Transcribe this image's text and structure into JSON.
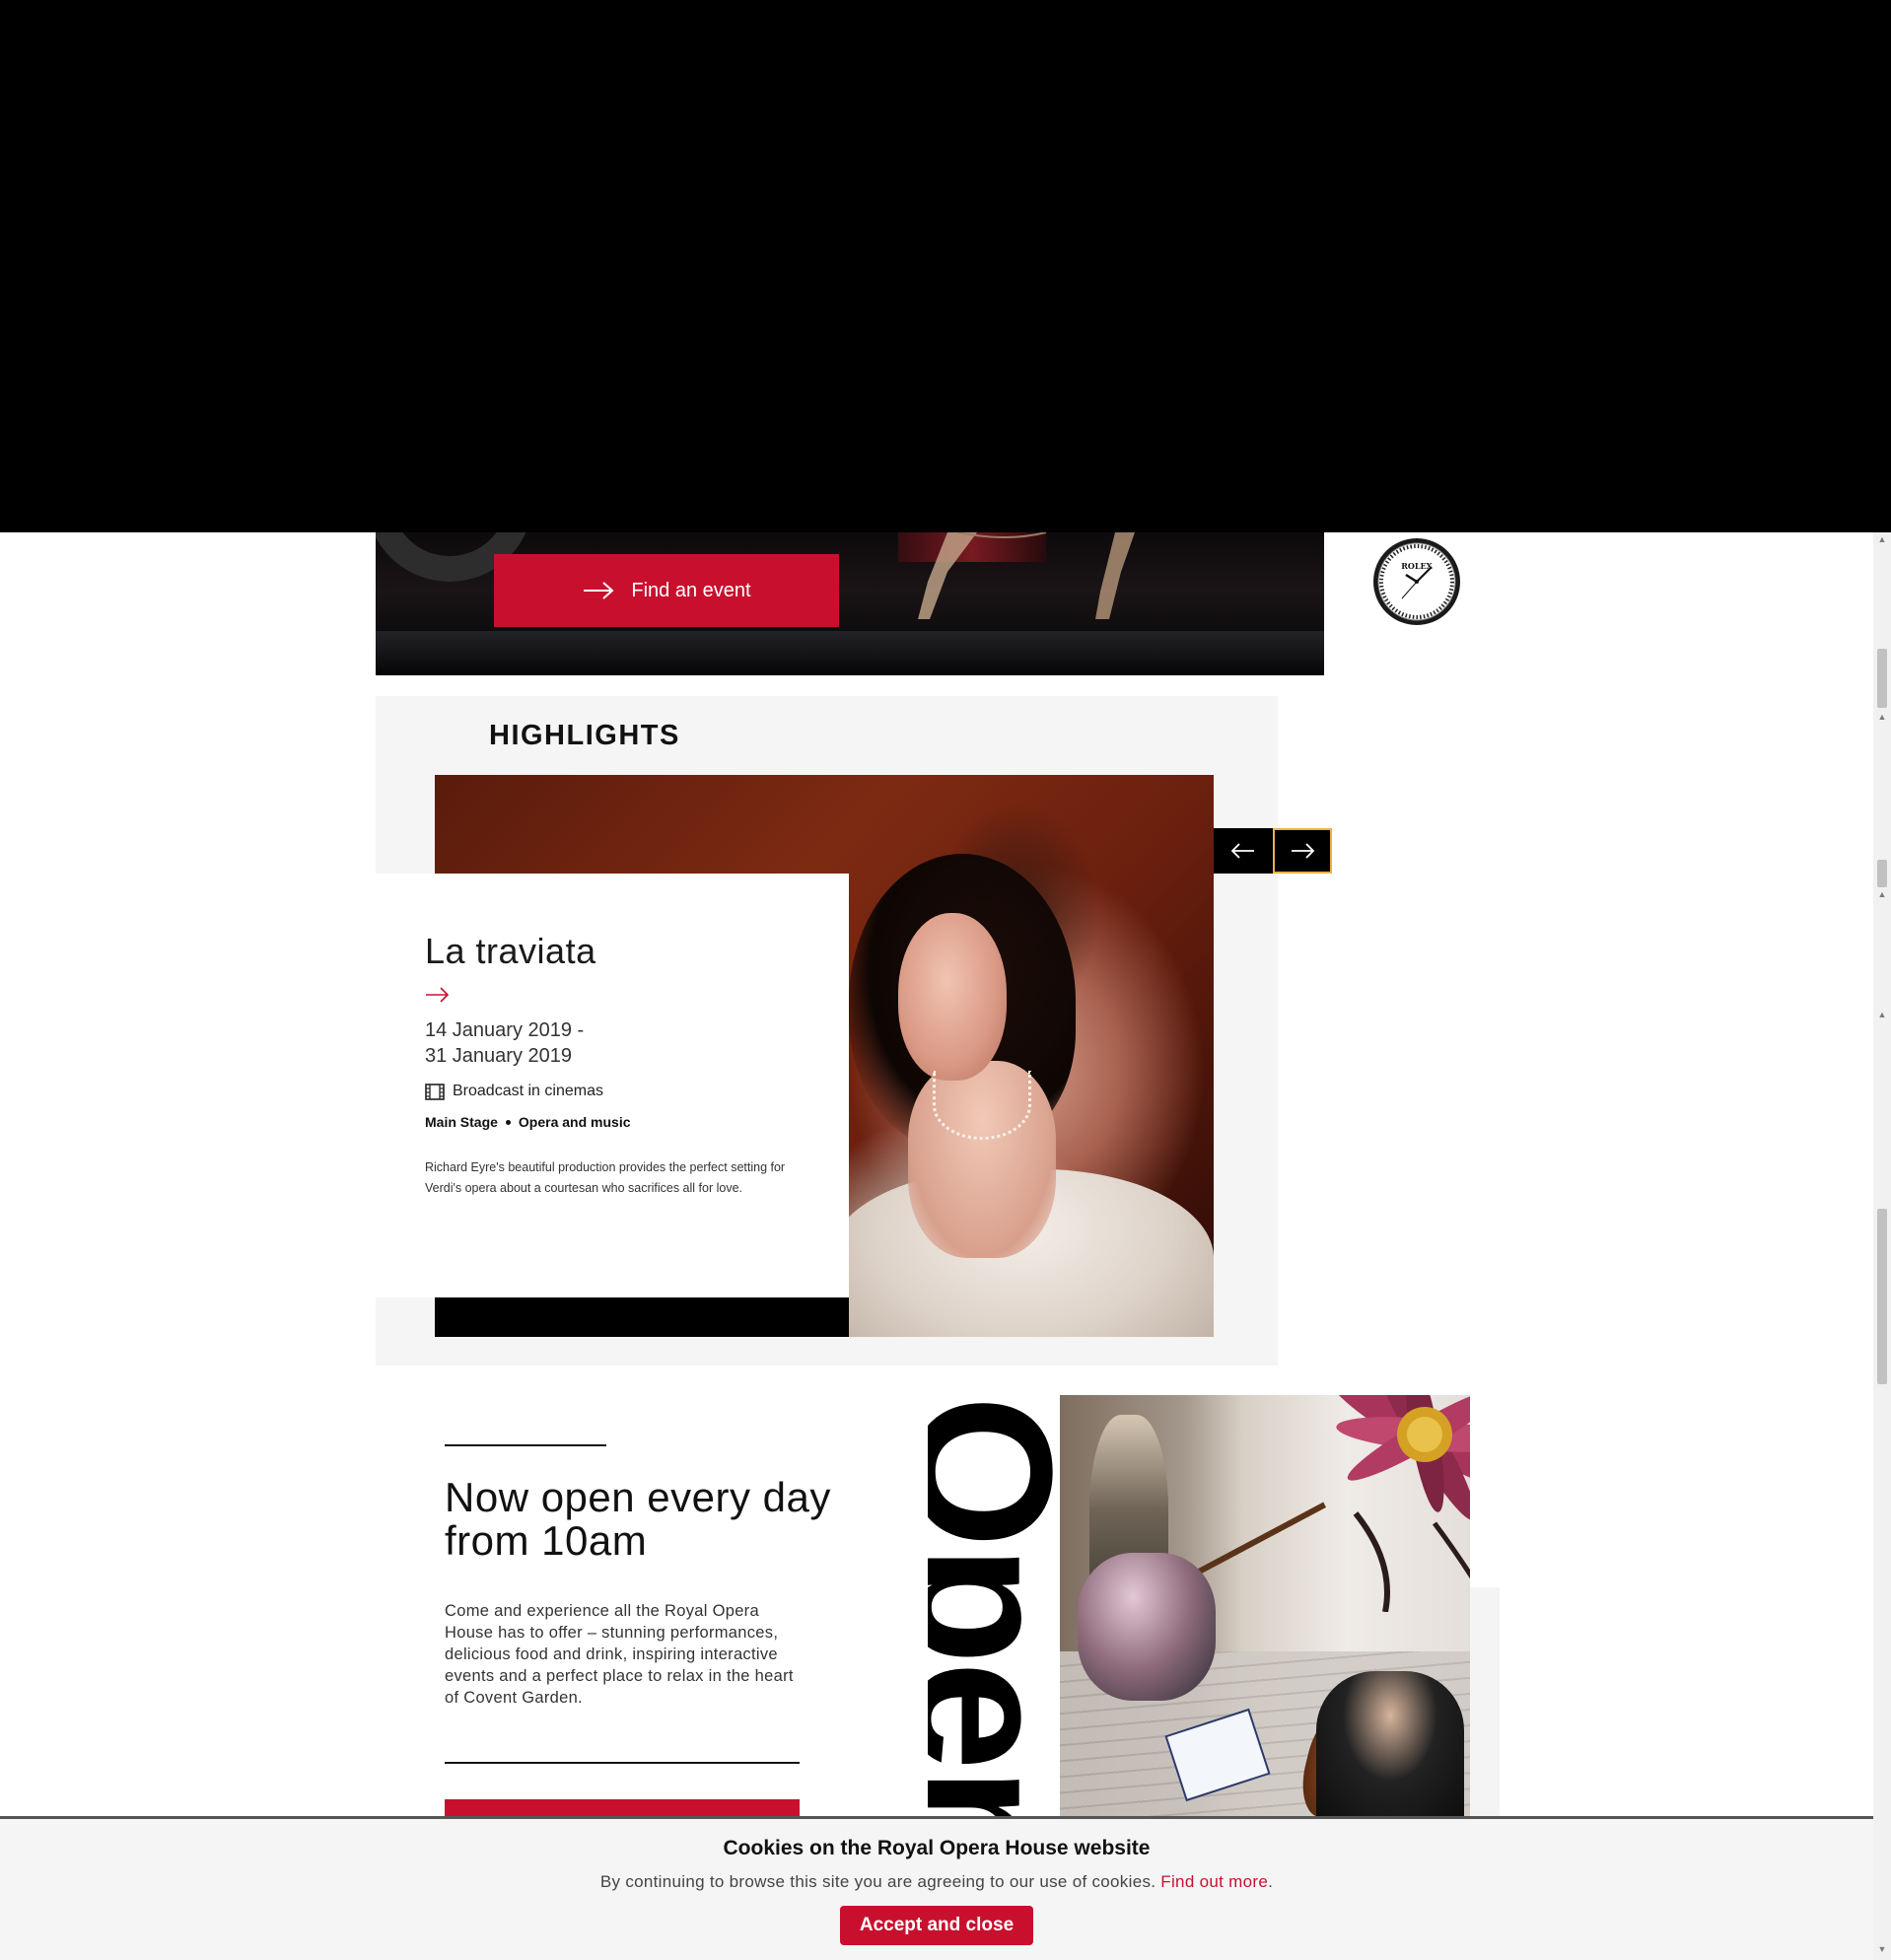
{
  "hero": {
    "find_button_label": "Find an event"
  },
  "sponsor": {
    "brand": "ROLEX"
  },
  "highlights": {
    "heading": "HIGHLIGHTS",
    "event": {
      "title": "La traviata",
      "date_start": "14 January 2019 -",
      "date_end": "31 January 2019",
      "broadcast": "Broadcast in cinemas",
      "venue": "Main Stage",
      "category": "Opera and music",
      "description": "Richard Eyre's beautiful production provides the perfect setting for Verdi's opera about a courtesan who sacrifices all for love."
    },
    "arrow_prev_icon": "arrow-left-icon",
    "arrow_next_icon": "arrow-right-icon"
  },
  "open": {
    "title": "Now open every day from 10am",
    "body": "Come and experience all the Royal Opera House has to offer – stunning performances, delicious food and drink, inspiring interactive events and a perfect place to relax in the heart of Covent Garden.",
    "big_word": "Open"
  },
  "cookie": {
    "title": "Cookies on the Royal Opera House website",
    "text": "By continuing to browse this site you are agreeing to our use of cookies. ",
    "link": "Find out more",
    "text_end": ".",
    "button": "Accept and close"
  },
  "colors": {
    "brand_red": "#c8102e",
    "arrow_border": "#e8b24a"
  }
}
